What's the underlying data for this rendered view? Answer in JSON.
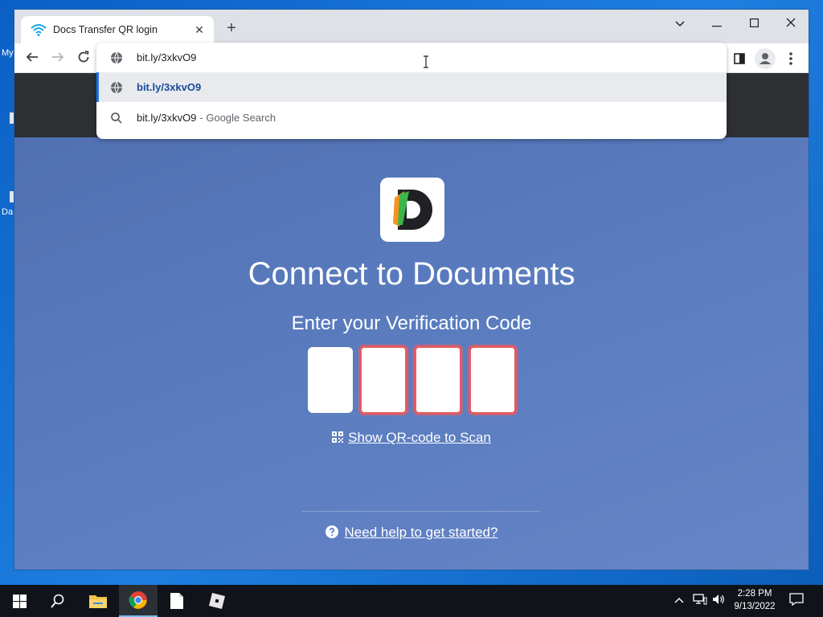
{
  "desktop": {
    "icon_label_1": "My",
    "icon_label_2": "Da"
  },
  "browser": {
    "tab_title": "Docs Transfer QR login",
    "tab_close": "✕",
    "new_tab": "+",
    "address": "bit.ly/3xkvO9"
  },
  "omnibox": {
    "suggestions": [
      {
        "text": "bit.ly/3xkvO9",
        "icon": "globe-icon"
      },
      {
        "text": "bit.ly/3xkvO9",
        "suffix": "- Google Search",
        "icon": "search-icon"
      }
    ]
  },
  "page": {
    "title": "Connect to Documents",
    "subtitle": "Enter your Verification Code",
    "qr_link": "Show QR-code to Scan",
    "help_link": "Need help to get started?"
  },
  "taskbar": {
    "time": "2:28 PM",
    "date": "9/13/2022"
  },
  "colors": {
    "page_bg": "#5b7dc0",
    "header_bg": "#2d2f33",
    "error_border": "#e55b63",
    "selected_accent": "#1a73e8"
  }
}
